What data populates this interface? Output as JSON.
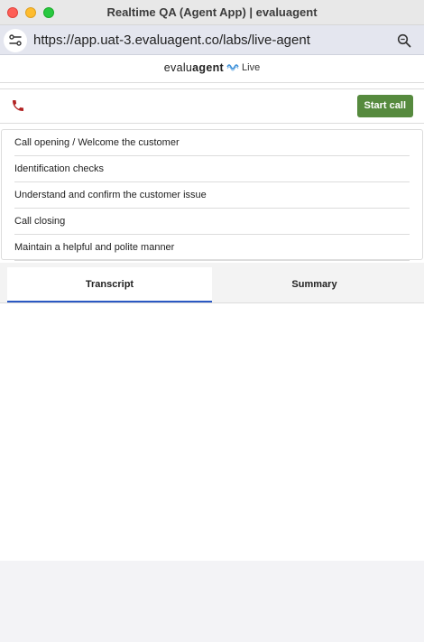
{
  "window": {
    "title": "Realtime QA (Agent App) | evaluagent"
  },
  "browser": {
    "url": "https://app.uat-3.evaluagent.co/labs/live-agent"
  },
  "brand": {
    "name_light": "evalu",
    "name_bold": "agent",
    "suffix": "Live",
    "accent": "#3a8fd9"
  },
  "call": {
    "start_label": "Start call",
    "phone_color": "#b22222",
    "button_color": "#568a3e"
  },
  "checklist": {
    "items": [
      {
        "label": "Call opening / Welcome the customer"
      },
      {
        "label": "Identification checks"
      },
      {
        "label": "Understand and confirm the customer issue"
      },
      {
        "label": "Call closing"
      },
      {
        "label": "Maintain a helpful and polite manner"
      }
    ]
  },
  "tabs": {
    "active": "Transcript",
    "items": [
      {
        "label": "Transcript"
      },
      {
        "label": "Summary"
      }
    ]
  }
}
